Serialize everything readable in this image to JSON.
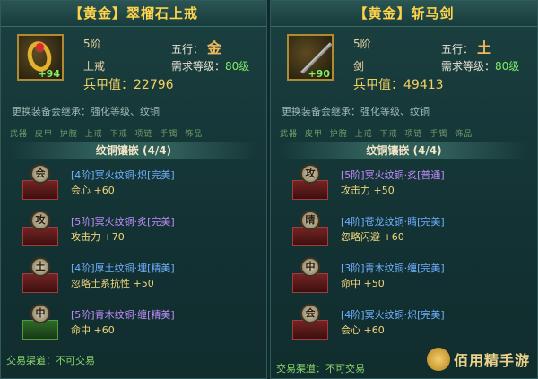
{
  "left": {
    "title": "【黄金】翠榴石上戒",
    "icon_plus": "+94",
    "rank": "5阶",
    "type": "上戒",
    "wuxing_label": "五行：",
    "wuxing_symbol": "金",
    "req_label": "需求等级：",
    "req_value": "80级",
    "power_label": "兵甲值：",
    "power_value": "22796",
    "inherit_text": "更换装备会继承：强化等级、纹铜",
    "tabs": [
      "武器",
      "皮甲",
      "护腕",
      "上戒",
      "下戒",
      "项链",
      "手镯",
      "饰品"
    ],
    "section_title": "纹铜镶嵌 (4/4)",
    "slots": [
      {
        "badge": "会",
        "title": "[4阶]冥火纹铜·炽[完美]",
        "color": "blue",
        "stat": "会心",
        "value": "+60",
        "book": "red"
      },
      {
        "badge": "攻",
        "title": "[5阶]冥火纹铜·炙[完美]",
        "color": "purple",
        "stat": "攻击力",
        "value": "+70",
        "book": "red"
      },
      {
        "badge": "土",
        "title": "[4阶]厚土纹铜·埋[精美]",
        "color": "blue",
        "stat": "忽略土系抗性",
        "value": "+50",
        "book": "red"
      },
      {
        "badge": "中",
        "title": "[5阶]青木纹铜·缠[精美]",
        "color": "purple",
        "stat": "命中",
        "value": "+60",
        "book": "green"
      }
    ],
    "trade_label": "交易渠道：不可交易"
  },
  "right": {
    "title": "【黄金】斩马剑",
    "icon_plus": "+90",
    "rank": "5阶",
    "type": "剑",
    "wuxing_label": "五行：",
    "wuxing_symbol": "土",
    "req_label": "需求等级：",
    "req_value": "80级",
    "power_label": "兵甲值：",
    "power_value": "49413",
    "inherit_text": "更换装备会继承：强化等级、纹铜",
    "tabs": [
      "武器",
      "皮甲",
      "护腕",
      "上戒",
      "下戒",
      "项链",
      "手镯",
      "饰品"
    ],
    "section_title": "纹铜镶嵌 (4/4)",
    "slots": [
      {
        "badge": "攻",
        "title": "[5阶]冥火纹铜·炙[普通]",
        "color": "purple",
        "stat": "攻击力",
        "value": "+50",
        "book": "red"
      },
      {
        "badge": "睛",
        "title": "[4阶]苍龙纹铜·睛[完美]",
        "color": "blue",
        "stat": "忽略闪避",
        "value": "+60",
        "book": "red"
      },
      {
        "badge": "中",
        "title": "[3阶]青木纹铜·缠[完美]",
        "color": "blue",
        "stat": "命中",
        "value": "+50",
        "book": "red"
      },
      {
        "badge": "会",
        "title": "[4阶]冥火纹铜·炽[完美]",
        "color": "blue",
        "stat": "会心",
        "value": "+60",
        "book": "red"
      }
    ],
    "trade_label": "交易渠道：不可交易"
  },
  "watermark": "佰用精手游"
}
